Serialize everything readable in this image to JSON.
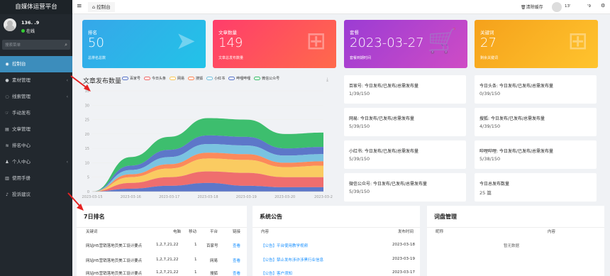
{
  "sidebar": {
    "brand": "自媒体运营平台",
    "user_name": "136.        .9",
    "status": "在线",
    "search_placeholder": "搜索菜单",
    "items": [
      {
        "label": "控制台",
        "icon": "dashboard-icon",
        "active": true
      },
      {
        "label": "素材管理",
        "icon": "material-icon",
        "chevron": "‹"
      },
      {
        "label": "线索管理",
        "icon": "clue-icon",
        "chevron": "‹"
      },
      {
        "label": "手动发布",
        "icon": "publish-icon"
      },
      {
        "label": "文章管理",
        "icon": "article-icon"
      },
      {
        "label": "排名中心",
        "icon": "ranking-icon"
      },
      {
        "label": "个人中心",
        "icon": "user-icon",
        "chevron": "‹"
      },
      {
        "label": "使用手册",
        "icon": "manual-icon"
      },
      {
        "label": "投诉建议",
        "icon": "feedback-icon"
      }
    ]
  },
  "topbar": {
    "tab_label": "控制台",
    "clear_cache": "清除缓存",
    "user": "13'",
    "nine": "'9"
  },
  "cards": [
    {
      "title": "排名",
      "value": "50",
      "sub": "总排名总数",
      "color": "#36a7e9"
    },
    {
      "title": "文章数量",
      "value": "149",
      "sub": "文章总发布数量",
      "color": "#ff3d6b"
    },
    {
      "title": "套餐",
      "value": "2023-03-27",
      "sub": "套餐到期时间",
      "color": "#9b3cd4"
    },
    {
      "title": "关键词",
      "value": "27",
      "sub": "剩余关键词",
      "color": "#f5a11b"
    }
  ],
  "chart_title": "文章发布数量",
  "chart_data": {
    "type": "area",
    "stacked": true,
    "categories": [
      "2023-03-15",
      "2023-03-16",
      "2023-03-17",
      "2023-03-18",
      "2023-03-19",
      "2023-03-20",
      "2023-03-2"
    ],
    "ylim": [
      0,
      35
    ],
    "yticks": [
      0,
      5,
      10,
      15,
      20,
      25,
      30,
      35
    ],
    "series": [
      {
        "name": "百家号",
        "color": "#5470c6",
        "values": [
          0,
          1,
          2,
          3,
          2,
          1.5,
          1.5
        ]
      },
      {
        "name": "今日头条",
        "color": "#ee6666",
        "values": [
          0,
          2,
          3,
          4,
          4.5,
          3.5,
          3.5
        ]
      },
      {
        "name": "网易",
        "color": "#fac858",
        "values": [
          0,
          2,
          3,
          4.5,
          4.5,
          3.5,
          4
        ]
      },
      {
        "name": "搜狐",
        "color": "#fc8452",
        "values": [
          0,
          1,
          1.5,
          2,
          2,
          1.5,
          1.5
        ]
      },
      {
        "name": "小红书",
        "color": "#73c0de",
        "values": [
          0,
          1.5,
          2.5,
          3,
          3,
          2.5,
          2.5
        ]
      },
      {
        "name": "哔哩哔哩",
        "color": "#5470c6",
        "values": [
          0,
          1.5,
          2.5,
          3,
          3,
          2.5,
          2.5
        ]
      },
      {
        "name": "微信公众号",
        "color": "#33bb66",
        "values": [
          0,
          3,
          4.5,
          6,
          6,
          5,
          5
        ]
      }
    ]
  },
  "platform_stats": [
    {
      "title": "百家号: 今日发布/已发布/总需发布量",
      "value": "1/39/150"
    },
    {
      "title": "今日头条: 今日发布/已发布/总需发布量",
      "value": "0/39/150"
    },
    {
      "title": "网易: 今日发布/已发布/总需发布量",
      "value": "5/39/150"
    },
    {
      "title": "搜狐: 今日发布/已发布/总需发布量",
      "value": "4/39/150"
    },
    {
      "title": "小红书: 今日发布/已发布/总需发布量",
      "value": "5/39/150"
    },
    {
      "title": "哔哩哔哩: 今日发布/已发布/总需发布量",
      "value": "5/38/150"
    },
    {
      "title": "微信公众号: 今日发布/已发布/总需发布量",
      "value": "5/39/150"
    },
    {
      "title": "今日总发布数量",
      "value": "25 篇"
    }
  ],
  "ranking": {
    "title": "7日排名",
    "headers": [
      "关键词",
      "电脑",
      "移动",
      "平台",
      "链接"
    ],
    "rows": [
      [
        "网站H5营销落地页美工设计要点",
        "1,2,7,21,22",
        "1",
        "百家号",
        "查看"
      ],
      [
        "网站H5营销落地页美工设计要点",
        "1,2,7,21,22",
        "1",
        "网易",
        "查看"
      ],
      [
        "网站H5营销落地页美工设计要点",
        "1,2,7,21,22",
        "1",
        "搜狐",
        "查看"
      ]
    ]
  },
  "notice": {
    "title": "系统公告",
    "headers": [
      "内容",
      "发布时间"
    ],
    "rows": [
      [
        "【公告】平台使用教学视频",
        "2023-03-18"
      ],
      [
        "【公告】禁止发布涉诈涉黑行业信息",
        "2023-03-19"
      ],
      [
        "【公告】客户须知",
        "2023-03-17"
      ]
    ]
  },
  "keywords": {
    "title": "词盘管理",
    "headers": [
      "昵称",
      "内容"
    ],
    "empty": "暂无数据"
  }
}
